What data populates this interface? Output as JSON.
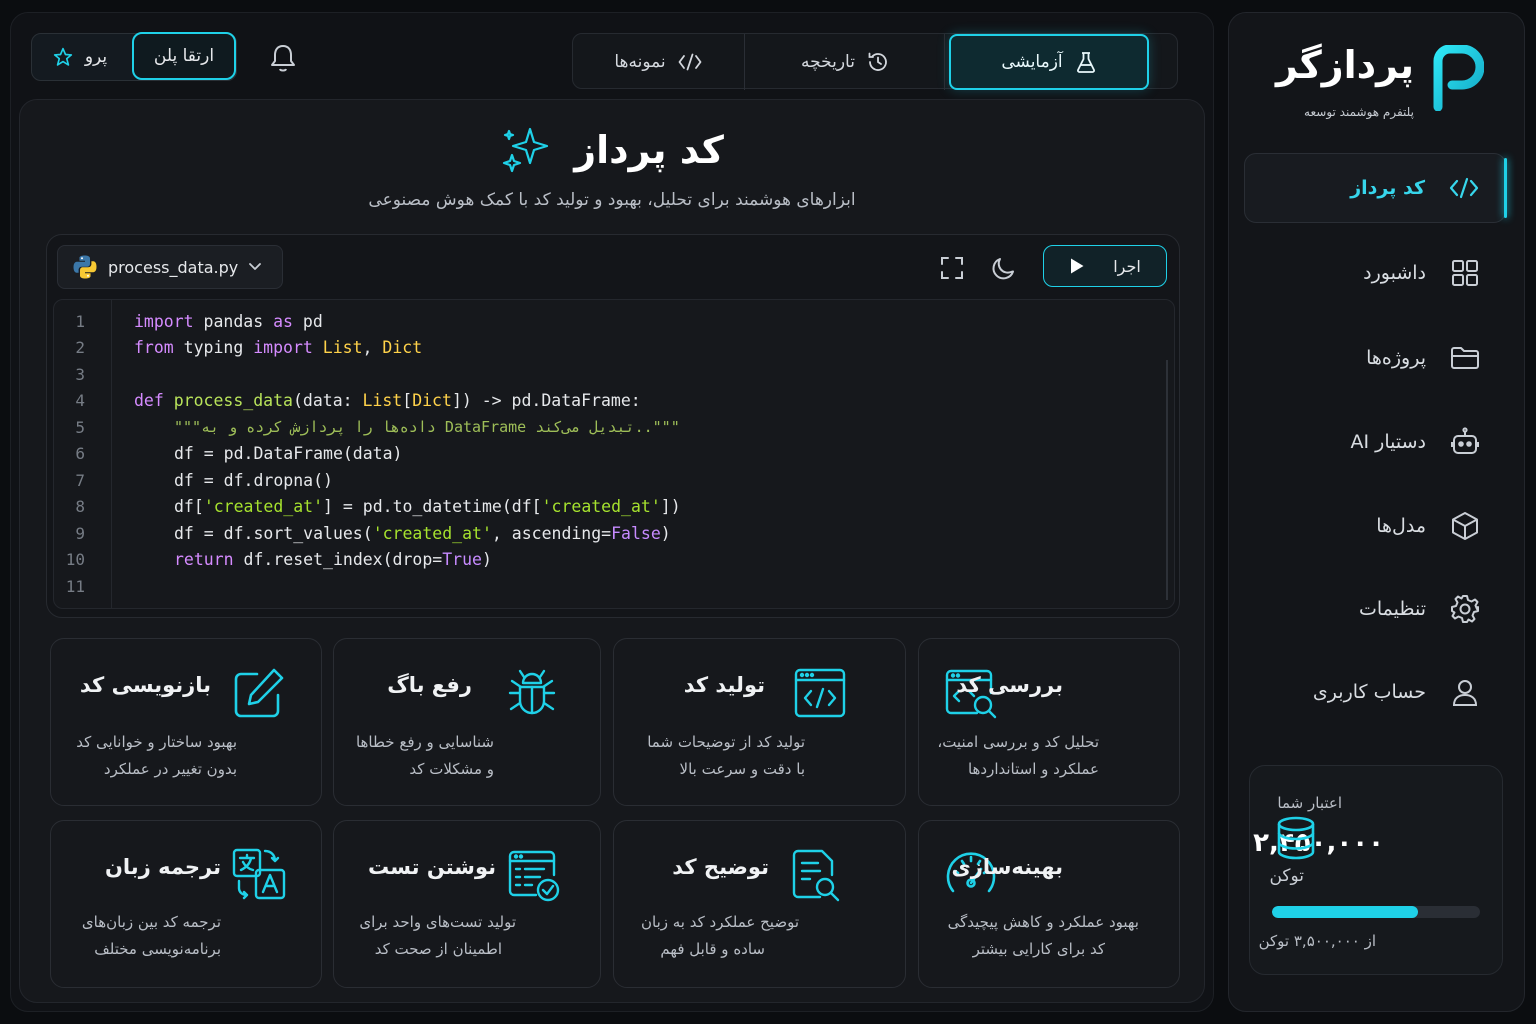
{
  "brand": {
    "name": "پردازگر",
    "tagline": "پلتفرم هوشمند توسعه",
    "accent": "#1fd1e8"
  },
  "sidebar": {
    "items": [
      {
        "label": "کد پرداز",
        "icon": "code-icon",
        "active": true
      },
      {
        "label": "داشبورد",
        "icon": "grid-icon",
        "active": false
      },
      {
        "label": "پروژه‌ها",
        "icon": "folder-icon",
        "active": false
      },
      {
        "label": "دستیار AI",
        "icon": "robot-icon",
        "active": false
      },
      {
        "label": "مدل‌ها",
        "icon": "cube-icon",
        "active": false
      },
      {
        "label": "تنظیمات",
        "icon": "gear-icon",
        "active": false
      },
      {
        "label": "حساب کاربری",
        "icon": "user-icon",
        "active": false
      }
    ]
  },
  "credit": {
    "label": "اعتبار شما",
    "value": "۲,۴۵۰,۰۰۰",
    "unit": "توکن",
    "of_text": "از ۳,۵۰۰,۰۰۰ توکن",
    "progress": 0.7
  },
  "header": {
    "pro_label": "پرو",
    "upgrade_label": "ارتقا پلن",
    "tabs": [
      {
        "label": "آزمایشی",
        "icon": "flask-icon",
        "active": true
      },
      {
        "label": "تاریخچه",
        "icon": "history-icon",
        "active": false
      },
      {
        "label": "نمونه‌ها",
        "icon": "code-icon",
        "active": false
      }
    ]
  },
  "page": {
    "title": "کد پرداز",
    "subtitle": "ابزارهای هوشمند برای تحلیل، بهبود و تولید کد با کمک هوش مصنوعی"
  },
  "editor": {
    "file_name": "process_data.py",
    "run_label": "اجرا",
    "line_numbers": [
      "1",
      "2",
      "3",
      "4",
      "5",
      "6",
      "7",
      "8",
      "9",
      "10",
      "11"
    ],
    "code": {
      "l1": {
        "kw1": "import",
        "mid": " pandas ",
        "kw2": "as",
        "end": " pd"
      },
      "l2": {
        "kw1": "from",
        "mid": " typing ",
        "kw2": "import",
        "t1": " List",
        "sep": ", ",
        "t2": "Dict"
      },
      "l4": {
        "kw": "def",
        "fn": " process_data",
        "a": "(data: ",
        "t1": "List",
        "b": "[",
        "t2": "Dict",
        "c": "]) -> pd.DataFrame:"
      },
      "l5": {
        "comment": "\"\"\"داده‌ها را پردازش کرده و به DataFrame تبدیل می‌کند..\"\"\""
      },
      "l6": {
        "text": "df = pd.DataFrame(data)"
      },
      "l7": {
        "text": "df = df.dropna()"
      },
      "l8": {
        "a": "df[",
        "s1": "'created_at'",
        "b": "] = pd.to_datetime(df[",
        "s2": "'created_at'",
        "c": "])"
      },
      "l9": {
        "a": "df = df.sort_values(",
        "s1": "'created_at'",
        "b": ", ascending=",
        "bool": "False",
        "c": ")"
      },
      "l10": {
        "kw": "return",
        "a": " df.reset_index(drop=",
        "bool": "True",
        "c": ")"
      }
    }
  },
  "cards": [
    {
      "title": "بررسی کد",
      "desc1": "تحلیل کد و بررسی امنیت،",
      "desc2": "عملکرد و استانداردها",
      "icon": "code-review-icon"
    },
    {
      "title": "تولید کد",
      "desc1": "تولید کد از توضیحات شما",
      "desc2": "با دقت و سرعت بالا",
      "icon": "code-window-icon"
    },
    {
      "title": "رفع باگ",
      "desc1": "شناسایی و رفع خطاها",
      "desc2": "و مشکلات کد",
      "icon": "bug-icon"
    },
    {
      "title": "بازنویسی کد",
      "desc1": "بهبود ساختار و خوانایی کد",
      "desc2": "بدون تغییر در عملکرد",
      "icon": "edit-icon"
    },
    {
      "title": "بهینه‌سازی",
      "desc1": "بهبود عملکرد و کاهش پیچیدگی",
      "desc2": "کد برای کارایی بیشتر",
      "icon": "speedometer-icon"
    },
    {
      "title": "توضیح کد",
      "desc1": "توضیح عملکرد کد به زبان",
      "desc2": "ساده و قابل فهم",
      "icon": "document-search-icon"
    },
    {
      "title": "نوشتن تست",
      "desc1": "تولید تست‌های واحد برای",
      "desc2": "اطمینان از صحت کد",
      "icon": "test-check-icon"
    },
    {
      "title": "ترجمه زبان",
      "desc1": "ترجمه کد بین زبان‌های",
      "desc2": "برنامه‌نویسی مختلف",
      "icon": "translate-icon"
    }
  ]
}
